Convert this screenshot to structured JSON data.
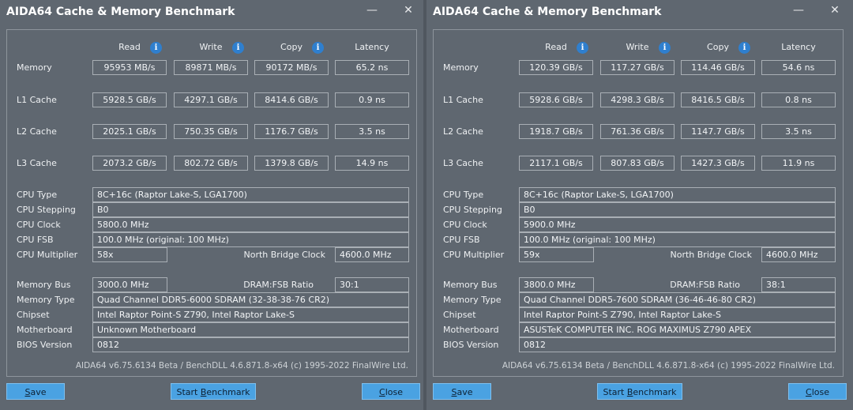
{
  "windows": [
    {
      "title": "AIDA64 Cache & Memory Benchmark",
      "headers": {
        "read": "Read",
        "write": "Write",
        "copy": "Copy",
        "latency": "Latency"
      },
      "rows": [
        {
          "label": "Memory",
          "read": "95953 MB/s",
          "write": "89871 MB/s",
          "copy": "90172 MB/s",
          "latency": "65.2 ns"
        },
        {
          "label": "L1 Cache",
          "read": "5928.5 GB/s",
          "write": "4297.1 GB/s",
          "copy": "8414.6 GB/s",
          "latency": "0.9 ns"
        },
        {
          "label": "L2 Cache",
          "read": "2025.1 GB/s",
          "write": "750.35 GB/s",
          "copy": "1176.7 GB/s",
          "latency": "3.5 ns"
        },
        {
          "label": "L3 Cache",
          "read": "2073.2 GB/s",
          "write": "802.72 GB/s",
          "copy": "1379.8 GB/s",
          "latency": "14.9 ns"
        }
      ],
      "cpu": {
        "type_label": "CPU Type",
        "type": "8C+16c   (Raptor Lake-S, LGA1700)",
        "stepping_label": "CPU Stepping",
        "stepping": "B0",
        "clock_label": "CPU Clock",
        "clock": "5800.0 MHz",
        "fsb_label": "CPU FSB",
        "fsb": "100.0 MHz  (original: 100 MHz)",
        "multiplier_label": "CPU Multiplier",
        "multiplier": "58x",
        "nb_clock_label": "North Bridge Clock",
        "nb_clock": "4600.0 MHz"
      },
      "memory": {
        "bus_label": "Memory Bus",
        "bus": "3000.0 MHz",
        "ratio_label": "DRAM:FSB Ratio",
        "ratio": "30:1",
        "type_label": "Memory Type",
        "type": "Quad Channel DDR5-6000 SDRAM  (32-38-38-76 CR2)",
        "chipset_label": "Chipset",
        "chipset": "Intel Raptor Point-S Z790, Intel Raptor Lake-S",
        "motherboard_label": "Motherboard",
        "motherboard": "Unknown Motherboard",
        "bios_label": "BIOS Version",
        "bios": "0812"
      },
      "footer": "AIDA64 v6.75.6134 Beta / BenchDLL 4.6.871.8-x64  (c) 1995-2022 FinalWire Ltd.",
      "buttons": {
        "save_u": "S",
        "save_rest": "ave",
        "start_pre": "Start ",
        "start_u": "B",
        "start_rest": "enchmark",
        "close_u": "C",
        "close_rest": "lose"
      }
    },
    {
      "title": "AIDA64 Cache & Memory Benchmark",
      "headers": {
        "read": "Read",
        "write": "Write",
        "copy": "Copy",
        "latency": "Latency"
      },
      "rows": [
        {
          "label": "Memory",
          "read": "120.39 GB/s",
          "write": "117.27 GB/s",
          "copy": "114.46 GB/s",
          "latency": "54.6 ns"
        },
        {
          "label": "L1 Cache",
          "read": "5928.6 GB/s",
          "write": "4298.3 GB/s",
          "copy": "8416.5 GB/s",
          "latency": "0.8 ns"
        },
        {
          "label": "L2 Cache",
          "read": "1918.7 GB/s",
          "write": "761.36 GB/s",
          "copy": "1147.7 GB/s",
          "latency": "3.5 ns"
        },
        {
          "label": "L3 Cache",
          "read": "2117.1 GB/s",
          "write": "807.83 GB/s",
          "copy": "1427.3 GB/s",
          "latency": "11.9 ns"
        }
      ],
      "cpu": {
        "type_label": "CPU Type",
        "type": "8C+16c   (Raptor Lake-S, LGA1700)",
        "stepping_label": "CPU Stepping",
        "stepping": "B0",
        "clock_label": "CPU Clock",
        "clock": "5900.0 MHz",
        "fsb_label": "CPU FSB",
        "fsb": "100.0 MHz  (original: 100 MHz)",
        "multiplier_label": "CPU Multiplier",
        "multiplier": "59x",
        "nb_clock_label": "North Bridge Clock",
        "nb_clock": "4600.0 MHz"
      },
      "memory": {
        "bus_label": "Memory Bus",
        "bus": "3800.0 MHz",
        "ratio_label": "DRAM:FSB Ratio",
        "ratio": "38:1",
        "type_label": "Memory Type",
        "type": "Quad Channel DDR5-7600 SDRAM  (36-46-46-80 CR2)",
        "chipset_label": "Chipset",
        "chipset": "Intel Raptor Point-S Z790, Intel Raptor Lake-S",
        "motherboard_label": "Motherboard",
        "motherboard": "ASUSTeK COMPUTER INC. ROG MAXIMUS Z790 APEX",
        "bios_label": "BIOS Version",
        "bios": "0812"
      },
      "footer": "AIDA64 v6.75.6134 Beta / BenchDLL 4.6.871.8-x64  (c) 1995-2022 FinalWire Ltd.",
      "buttons": {
        "save_u": "S",
        "save_rest": "ave",
        "start_pre": "Start ",
        "start_u": "B",
        "start_rest": "enchmark",
        "close_u": "C",
        "close_rest": "lose"
      }
    }
  ],
  "icons": {
    "info": "info-icon",
    "minimize": "minimize-icon",
    "close": "close-icon"
  },
  "colors": {
    "background": "#5f6770",
    "button": "#4aa2e2",
    "info_icon": "#2f7fce"
  }
}
